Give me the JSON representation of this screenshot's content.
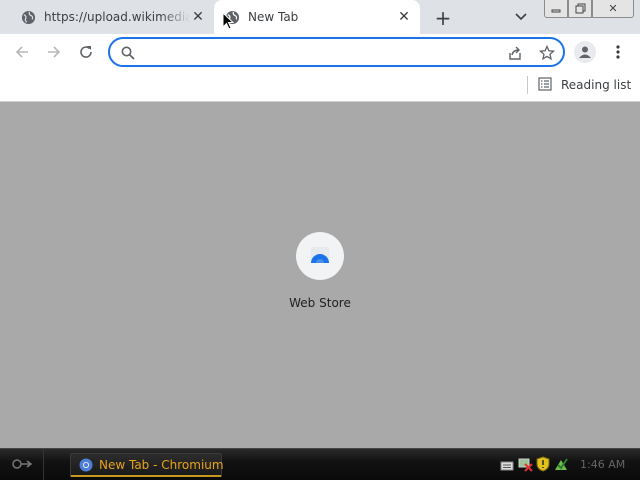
{
  "tabs": [
    {
      "title": "https://upload.wikimedia.org",
      "favicon": "globe-icon",
      "active": false
    },
    {
      "title": "New Tab",
      "favicon": "globe-icon",
      "active": true
    }
  ],
  "omnibox": {
    "placeholder": "",
    "value": ""
  },
  "bookmarks": {
    "reading_list_label": "Reading list"
  },
  "shortcuts": [
    {
      "label": "Web Store",
      "icon": "web-store-icon"
    }
  ],
  "taskbar": {
    "task_label": "New Tab - Chromium",
    "clock": "1:46 AM"
  },
  "colors": {
    "accent": "#1a73e8",
    "content_bg": "#a9a9a9",
    "task_text": "#e8a317"
  }
}
